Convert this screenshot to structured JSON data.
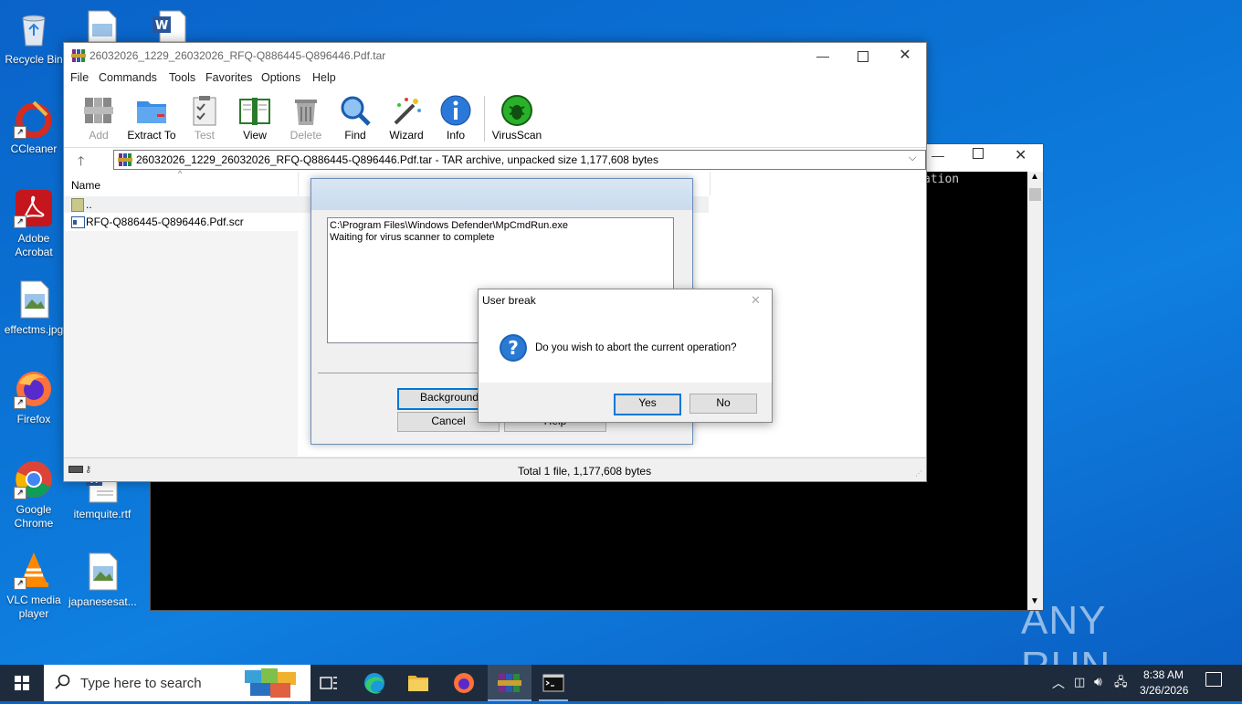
{
  "desktop": {
    "icons": [
      {
        "label": "Recycle Bin"
      },
      {
        "label": "CCleaner"
      },
      {
        "label": "Adobe Acrobat"
      },
      {
        "label": "effectms.jpg"
      },
      {
        "label": "Firefox"
      },
      {
        "label": "Google Chrome"
      },
      {
        "label": "VLC media player"
      },
      {
        "label": "itemquite.rtf"
      },
      {
        "label": "japanesesat..."
      }
    ],
    "watermark": "ANY RUN"
  },
  "console": {
    "partial_text": "ation"
  },
  "winrar": {
    "title": "26032026_1229_26032026_RFQ-Q886445-Q896446.Pdf.tar",
    "menu": [
      "File",
      "Commands",
      "Tools",
      "Favorites",
      "Options",
      "Help"
    ],
    "toolbar": [
      {
        "label": "Add",
        "enabled": false
      },
      {
        "label": "Extract To",
        "enabled": true
      },
      {
        "label": "Test",
        "enabled": false
      },
      {
        "label": "View",
        "enabled": true
      },
      {
        "label": "Delete",
        "enabled": false
      },
      {
        "label": "Find",
        "enabled": true
      },
      {
        "label": "Wizard",
        "enabled": true
      },
      {
        "label": "Info",
        "enabled": true
      },
      {
        "label": "VirusScan",
        "enabled": true
      }
    ],
    "address": "26032026_1229_26032026_RFQ-Q886445-Q896446.Pdf.tar - TAR archive, unpacked size 1,177,608 bytes",
    "column_name": "Name",
    "files": [
      {
        "name": ".."
      },
      {
        "name": "RFQ-Q886445-Q896446.Pdf.scr"
      }
    ],
    "status": "Total 1 file, 1,177,608 bytes"
  },
  "progress": {
    "log": [
      "C:\\Program Files\\Windows Defender\\MpCmdRun.exe",
      "Waiting for virus scanner to complete"
    ],
    "buttons": {
      "background": "Background",
      "cancel": "Cancel",
      "help": "Help"
    }
  },
  "msgbox": {
    "title": "User break",
    "message": "Do you wish to abort the current operation?",
    "yes": "Yes",
    "no": "No"
  },
  "taskbar": {
    "search_placeholder": "Type here to search",
    "time": "8:38 AM",
    "date": "3/26/2026"
  }
}
